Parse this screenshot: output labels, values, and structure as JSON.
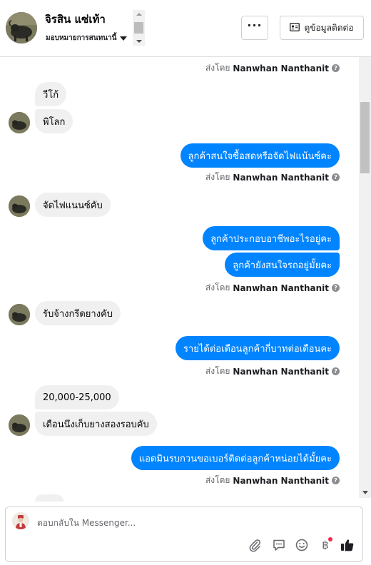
{
  "header": {
    "contact_name": "จิรสิน แซ่เท้า",
    "assign_label": "มอบหมายการสนทนานี้",
    "more_label": "···",
    "contact_info_label": "ดูข้อมูลติดต่อ"
  },
  "conversation": {
    "sent_by_prefix": "ส่งโดย",
    "sender_name": "Nanwhan Nanthanit",
    "info_glyph": "?",
    "messages": [
      {
        "dir": "in",
        "text": "วีโก้"
      },
      {
        "dir": "in",
        "text": "พิโลก"
      },
      {
        "dir": "out",
        "text": "ลูกค้าสนใจซื้อสดหรือจัดไฟแน้นซ์คะ"
      },
      {
        "dir": "in",
        "text": "จัดไฟแนนซ์คับ"
      },
      {
        "dir": "out",
        "text": "ลูกค้าประกอบอาชีพอะไรอยู่คะ"
      },
      {
        "dir": "out",
        "text": "ลูกค้ายังสนใจรถอยู่มั้ยคะ"
      },
      {
        "dir": "in",
        "text": "รับจ้างกรีดยางคับ"
      },
      {
        "dir": "out",
        "text": "รายได้ต่อเดือนลูกค้ากี่บาทต่อเดือนคะ"
      },
      {
        "dir": "in",
        "text": "20,000-25,000"
      },
      {
        "dir": "in",
        "text": "เดือนนึงเก็บยางสองรอบคับ"
      },
      {
        "dir": "out",
        "text": "แอดมินรบกวนขอเบอร์ติดต่อลูกค้าหน่อยได้มั้ยคะ"
      }
    ]
  },
  "composer": {
    "placeholder": "ตอบกลับใน Messenger...",
    "tools": [
      "paperclip-icon",
      "saved-reply-icon",
      "emoji-icon",
      "baht-payment-icon",
      "thumbs-up-icon"
    ]
  },
  "colors": {
    "outgoing_bubble": "#0084ff",
    "incoming_bubble": "#f0f0f0",
    "notification_dot": "#f02849"
  }
}
